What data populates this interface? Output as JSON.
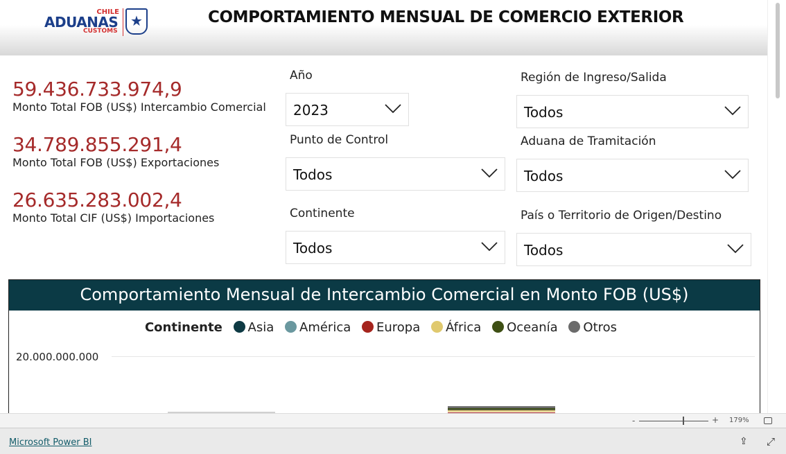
{
  "header": {
    "logo_text": {
      "top": "CHILE",
      "main": "ADUANAS",
      "bottom": "CUSTOMS"
    },
    "title": "COMPORTAMIENTO MENSUAL DE COMERCIO EXTERIOR"
  },
  "kpis": [
    {
      "value": "59.436.733.974,9",
      "label": "Monto Total FOB (US$) Intercambio Comercial"
    },
    {
      "value": "34.789.855.291,4",
      "label": "Monto Total FOB (US$) Exportaciones"
    },
    {
      "value": "26.635.283.002,4",
      "label": "Monto Total CIF (US$) Importaciones"
    }
  ],
  "filters": {
    "anio": {
      "label": "Año",
      "value": "2023"
    },
    "region": {
      "label": "Región de Ingreso/Salida",
      "value": "Todos"
    },
    "punto": {
      "label": "Punto de Control",
      "value": "Todos"
    },
    "aduana": {
      "label": "Aduana de Tramitación",
      "value": "Todos"
    },
    "continente": {
      "label": "Continente",
      "value": "Todos"
    },
    "pais": {
      "label": "País o Territorio de Origen/Destino",
      "value": "Todos"
    }
  },
  "chart": {
    "title": "Comportamiento Mensual de Intercambio Comercial en Monto FOB (US$)",
    "legend_title": "Continente",
    "legend": [
      {
        "name": "Asia",
        "color": "#0e3a44"
      },
      {
        "name": "América",
        "color": "#6a989f"
      },
      {
        "name": "Europa",
        "color": "#a5241d"
      },
      {
        "name": "África",
        "color": "#e0c96e"
      },
      {
        "name": "Oceanía",
        "color": "#3e4f14"
      },
      {
        "name": "Otros",
        "color": "#6b6b6b"
      }
    ],
    "y_tick": "20.000.000.000"
  },
  "zoom": {
    "level": "179%",
    "minus": "-",
    "plus": "+"
  },
  "footer": {
    "link": "Microsoft Power BI"
  }
}
